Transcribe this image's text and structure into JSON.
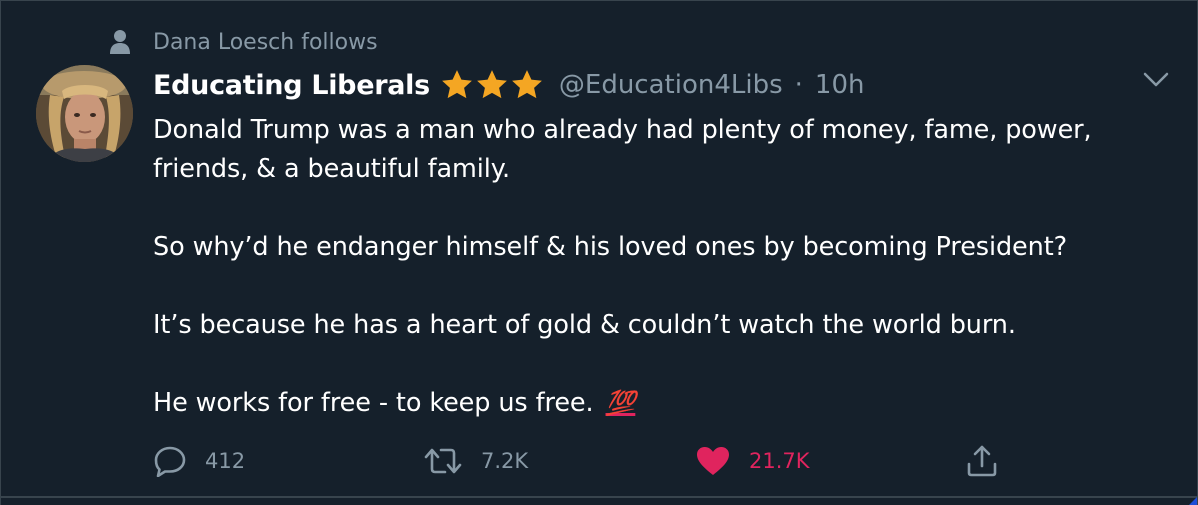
{
  "social_context": {
    "text": "Dana Loesch follows",
    "icon": "person-icon"
  },
  "author": {
    "display_name": "Educating Liberals",
    "stars": [
      "star-icon",
      "star-icon",
      "star-icon"
    ],
    "star_color": "#f4a623",
    "handle": "@Education4Libs",
    "separator": "·",
    "time": "10h"
  },
  "tweet": {
    "lines": [
      "Donald Trump was a man who already had plenty of money, fame, power,",
      "friends, & a beautiful family.",
      "So why’d he endanger himself & his loved ones by becoming President?",
      "It’s because he has a heart of gold & couldn’t watch the world burn.",
      "He works for free - to keep us free."
    ],
    "emoji": "💯"
  },
  "actions": {
    "reply_count": "412",
    "retweet_count": "7.2K",
    "like_count": "21.7K",
    "liked": true,
    "like_color": "#e0245e"
  },
  "colors": {
    "background": "#15202b",
    "secondary_text": "#8899a6",
    "border": "#38444d"
  }
}
